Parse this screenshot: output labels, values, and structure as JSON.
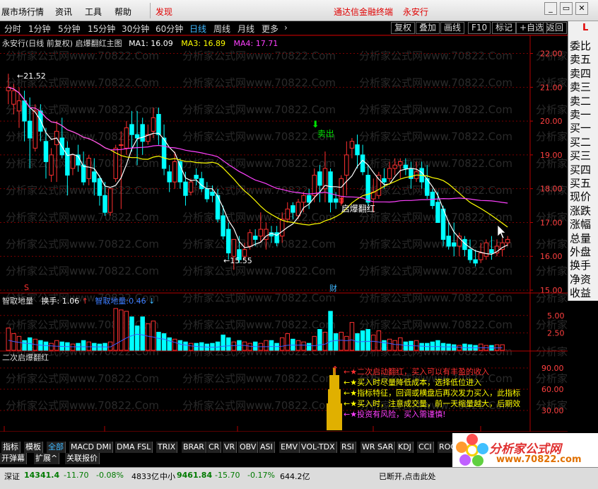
{
  "menu": {
    "items": [
      "展市场行情",
      "资讯",
      "工具",
      "帮助",
      "发现"
    ],
    "title_center": "通达信金融终端",
    "stock_name": "永安行",
    "win_buttons": [
      "_",
      "▭",
      "✕"
    ]
  },
  "periods": [
    "分时",
    "1分钟",
    "5分钟",
    "15分钟",
    "30分钟",
    "60分钟",
    "日线",
    "周线",
    "月线",
    "更多"
  ],
  "periods_active": "日线",
  "toolbar": [
    "复权",
    "叠加",
    "画线",
    "F10",
    "标记",
    "+自选",
    "返回"
  ],
  "right_panel": {
    "corner": "L",
    "labels": [
      "委比",
      "卖五",
      "卖四",
      "卖三",
      "卖二",
      "卖一",
      "买一",
      "买二",
      "买三",
      "买四",
      "买五",
      "现价",
      "涨跌",
      "涨幅",
      "总量",
      "外盘",
      "换手",
      "净资",
      "收益"
    ]
  },
  "main_legend": {
    "name": "永安行(日线 前复权) 启爆翻红主图",
    "ma1": "MA1: 16.09",
    "ma3": "MA3: 16.89",
    "ma4": "MA4: 17.71"
  },
  "annotations": {
    "high": "21.52",
    "low": "15.55",
    "sell": "卖出",
    "buy": "启爆翻红",
    "s_mark": "S",
    "cai_mark": "财",
    "watermark": "分析家公式网www.70822.Com"
  },
  "vol_legend": {
    "name": "智取地量",
    "turnover": "换手: 1.06",
    "extra": "智取地量:0.46"
  },
  "ind_legend": {
    "name": "二次启爆翻红"
  },
  "ind_notes": [
    "★二次启动翻红，买入可以有丰盈的收入",
    "★买入时尽量降低成本，选择低位进入",
    "★指标特征，回调或横盘后再次发力买入，此指标",
    "★买入时，注意成交量，前一天缩量越大，后期效",
    "★投资有风险，买入需谨慎!"
  ],
  "axes": {
    "price_ticks": [
      "22.00",
      "21.00",
      "20.00",
      "19.00",
      "18.00",
      "17.00",
      "16.00",
      "15.00"
    ],
    "vol_ticks": [
      "5.00",
      "2.50"
    ],
    "ind_ticks": [
      "90.00",
      "60.00",
      "30.00"
    ],
    "date_labels": [
      "2021年",
      "7",
      "8",
      "9",
      "10"
    ],
    "day_tag": "日线"
  },
  "chart_data": {
    "type": "candlestick",
    "title": "永安行(日线 前复权)",
    "ylim": [
      15.0,
      22.2
    ],
    "candles": [
      [
        20.9,
        21.4,
        21.0,
        20.5
      ],
      [
        20.5,
        21.1,
        20.9,
        20.2
      ],
      [
        20.3,
        21.0,
        20.6,
        19.8
      ],
      [
        20.6,
        20.9,
        20.0,
        19.4
      ],
      [
        20.0,
        20.7,
        19.5,
        18.6
      ],
      [
        19.2,
        20.5,
        20.3,
        19.1
      ],
      [
        20.3,
        20.5,
        19.7,
        19.4
      ],
      [
        19.4,
        19.8,
        18.8,
        18.3
      ],
      [
        18.4,
        19.2,
        19.0,
        18.2
      ],
      [
        19.3,
        20.0,
        19.7,
        18.2
      ],
      [
        19.5,
        20.1,
        19.0,
        18.9
      ],
      [
        19.2,
        19.4,
        18.4,
        17.8
      ],
      [
        18.6,
        19.0,
        19.0,
        18.4
      ],
      [
        19.0,
        19.3,
        18.7,
        18.5
      ],
      [
        18.7,
        19.1,
        18.2,
        18.1
      ],
      [
        18.3,
        19.0,
        18.9,
        18.1
      ],
      [
        18.5,
        18.9,
        18.2,
        17.8
      ],
      [
        18.3,
        18.4,
        17.8,
        17.5
      ],
      [
        17.8,
        18.2,
        17.3,
        17.2
      ],
      [
        17.3,
        18.0,
        18.0,
        17.2
      ],
      [
        18.3,
        19.3,
        19.2,
        18.2
      ],
      [
        19.3,
        19.7,
        19.3,
        17.4
      ],
      [
        19.2,
        20.0,
        19.8,
        19.0
      ],
      [
        19.9,
        20.3,
        19.6,
        19.1
      ],
      [
        19.6,
        20.3,
        19.5,
        18.7
      ],
      [
        19.9,
        20.1,
        19.4,
        19.0
      ],
      [
        19.4,
        19.9,
        19.6,
        19.3
      ],
      [
        19.7,
        20.4,
        20.1,
        19.5
      ],
      [
        20.2,
        20.4,
        19.6,
        19.3
      ],
      [
        19.5,
        19.9,
        18.6,
        18.4
      ],
      [
        18.5,
        18.7,
        18.2,
        17.9
      ],
      [
        18.2,
        19.1,
        18.8,
        18.0
      ],
      [
        18.8,
        18.9,
        18.2,
        18.0
      ],
      [
        18.2,
        18.5,
        17.8,
        17.5
      ],
      [
        17.9,
        18.3,
        18.2,
        17.8
      ],
      [
        18.4,
        18.6,
        18.3,
        18.1
      ],
      [
        18.3,
        18.5,
        18.0,
        17.9
      ],
      [
        18.0,
        18.2,
        17.7,
        17.6
      ],
      [
        17.9,
        18.1,
        17.8,
        17.6
      ],
      [
        17.8,
        18.0,
        17.1,
        17.0
      ],
      [
        17.2,
        17.5,
        16.6,
        16.5
      ],
      [
        16.8,
        17.0,
        16.1,
        15.9
      ],
      [
        16.0,
        16.5,
        16.5,
        15.6
      ],
      [
        16.2,
        16.6,
        15.9,
        15.8
      ],
      [
        16.0,
        16.4,
        16.2,
        15.9
      ],
      [
        16.3,
        16.8,
        16.7,
        16.2
      ],
      [
        16.6,
        16.8,
        16.5,
        16.3
      ],
      [
        16.6,
        17.3,
        16.8,
        16.4
      ],
      [
        16.5,
        17.0,
        16.8,
        16.2
      ],
      [
        16.7,
        16.9,
        16.6,
        16.4
      ],
      [
        16.7,
        16.9,
        16.4,
        16.3
      ],
      [
        16.6,
        17.3,
        17.1,
        16.4
      ],
      [
        17.1,
        17.6,
        17.4,
        17.0
      ],
      [
        17.5,
        17.6,
        17.3,
        17.1
      ],
      [
        17.2,
        17.7,
        17.6,
        17.1
      ],
      [
        17.6,
        17.9,
        17.8,
        17.3
      ],
      [
        17.8,
        18.0,
        17.6,
        17.4
      ],
      [
        17.8,
        18.6,
        18.4,
        17.6
      ],
      [
        18.5,
        18.7,
        18.1,
        17.6
      ],
      [
        18.0,
        19.1,
        18.6,
        17.6
      ],
      [
        18.5,
        18.6,
        17.6,
        17.3
      ],
      [
        17.7,
        17.9,
        17.6,
        17.4
      ],
      [
        17.6,
        18.4,
        18.3,
        17.5
      ],
      [
        18.4,
        19.4,
        19.0,
        17.8
      ],
      [
        19.2,
        19.5,
        19.4,
        18.9
      ],
      [
        19.3,
        19.6,
        19.0,
        18.6
      ],
      [
        19.0,
        19.3,
        18.5,
        18.4
      ],
      [
        18.4,
        18.7,
        17.6,
        17.5
      ],
      [
        17.7,
        18.3,
        17.9,
        17.3
      ],
      [
        17.8,
        18.5,
        18.4,
        17.7
      ],
      [
        18.3,
        18.6,
        18.2,
        18.0
      ],
      [
        18.3,
        18.8,
        18.6,
        18.2
      ],
      [
        18.6,
        18.9,
        18.7,
        18.4
      ],
      [
        18.7,
        18.9,
        18.8,
        18.3
      ],
      [
        18.7,
        18.9,
        18.6,
        18.4
      ],
      [
        18.6,
        18.8,
        18.3,
        18.0
      ],
      [
        18.3,
        18.8,
        18.5,
        18.2
      ],
      [
        18.6,
        18.8,
        18.2,
        18.0
      ],
      [
        18.3,
        18.7,
        17.8,
        17.7
      ],
      [
        17.9,
        18.0,
        17.5,
        17.4
      ],
      [
        17.6,
        17.9,
        17.0,
        17.0
      ],
      [
        17.4,
        17.5,
        16.5,
        16.3
      ],
      [
        16.6,
        17.0,
        16.3,
        16.2
      ],
      [
        16.4,
        17.0,
        16.3,
        16.0
      ],
      [
        16.3,
        16.7,
        16.6,
        16.0
      ],
      [
        16.5,
        16.6,
        16.2,
        16.0
      ],
      [
        16.2,
        16.5,
        15.9,
        15.8
      ],
      [
        15.9,
        16.2,
        15.8,
        15.7
      ],
      [
        15.9,
        16.4,
        16.1,
        15.8
      ],
      [
        16.0,
        16.5,
        16.4,
        15.9
      ],
      [
        16.2,
        16.6,
        16.1,
        15.9
      ],
      [
        16.1,
        16.5,
        16.3,
        16.0
      ],
      [
        16.2,
        16.6,
        16.4,
        16.0
      ],
      [
        16.4,
        16.6,
        16.5,
        16.3
      ]
    ],
    "volume": [
      3.2,
      2.4,
      2.0,
      1.4,
      1.8,
      1.6,
      1.4,
      1.2,
      1.0,
      1.4,
      1.2,
      1.1,
      0.9,
      1.0,
      1.4,
      1.2,
      1.0,
      0.9,
      1.0,
      1.2,
      6.0,
      5.8,
      5.6,
      4.8,
      3.5,
      4.8,
      3.8,
      4.2,
      2.6,
      2.4,
      1.8,
      1.6,
      1.4,
      1.2,
      1.0,
      1.0,
      1.1,
      0.9,
      1.0,
      1.2,
      2.2,
      1.8,
      1.2,
      1.4,
      1.2,
      1.0,
      1.2,
      1.0,
      1.4,
      1.4,
      1.0,
      1.8,
      2.4,
      1.6,
      1.4,
      1.2,
      1.0,
      2.0,
      3.0,
      2.6,
      5.6,
      2.4,
      2.6,
      2.0,
      4.0,
      2.4,
      2.8,
      3.0,
      2.2,
      2.8,
      1.4,
      1.6,
      1.4,
      1.8,
      1.2,
      1.3,
      1.4,
      1.0,
      1.0,
      1.2,
      1.4,
      1.0,
      0.9,
      0.8,
      0.7,
      0.9,
      0.8,
      0.7,
      0.9,
      0.7,
      0.7,
      0.8,
      0.8
    ]
  }
}
